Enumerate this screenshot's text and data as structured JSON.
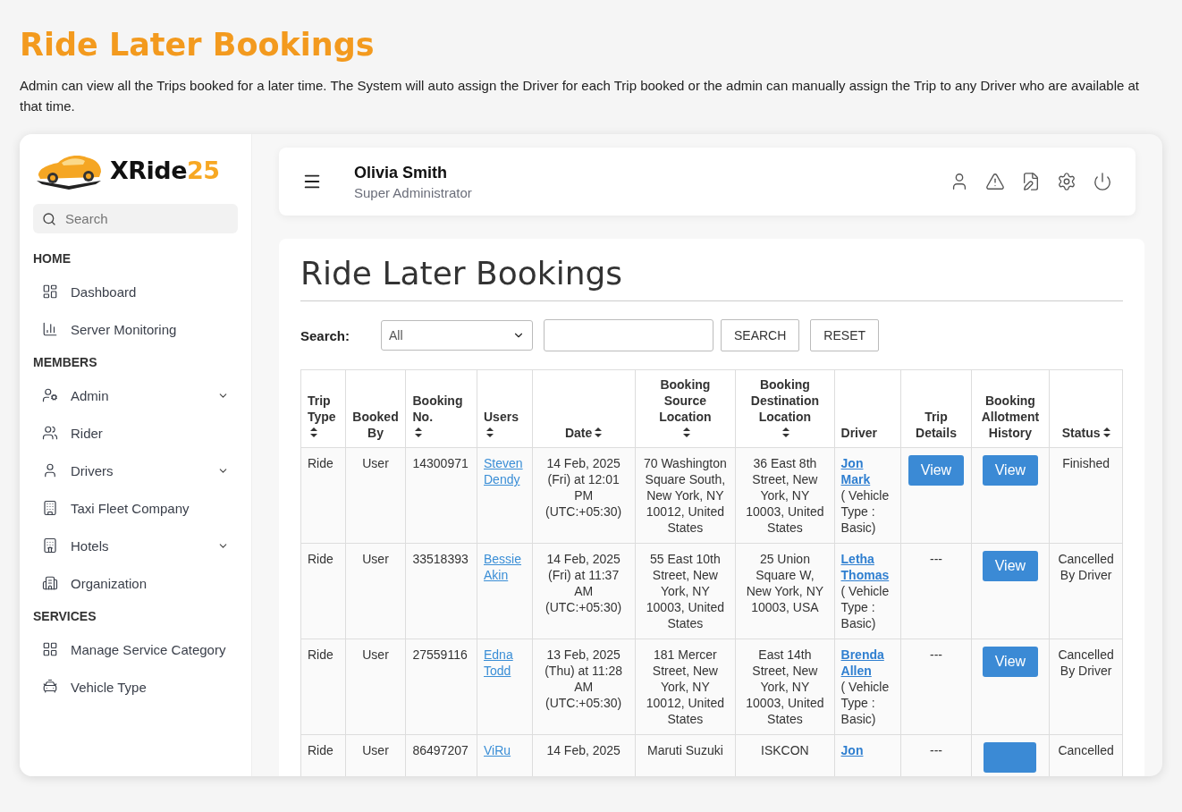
{
  "page": {
    "title": "Ride Later Bookings",
    "description": "Admin can view all the Trips booked for a later time. The System will auto assign the Driver for each Trip booked or the admin can manually assign the Trip to any Driver who are available at that time."
  },
  "sidebar": {
    "logo": {
      "text": "XRide",
      "accent": "25"
    },
    "search": {
      "placeholder": "Search"
    },
    "sections": [
      {
        "title": "HOME",
        "items": [
          {
            "label": "Dashboard",
            "expandable": false
          },
          {
            "label": "Server Monitoring",
            "expandable": false
          }
        ]
      },
      {
        "title": "MEMBERS",
        "items": [
          {
            "label": "Admin",
            "expandable": true
          },
          {
            "label": "Rider",
            "expandable": false
          },
          {
            "label": "Drivers",
            "expandable": true
          },
          {
            "label": "Taxi Fleet Company",
            "expandable": false
          },
          {
            "label": "Hotels",
            "expandable": true
          },
          {
            "label": "Organization",
            "expandable": false
          }
        ]
      },
      {
        "title": "SERVICES",
        "items": [
          {
            "label": "Manage Service Category",
            "expandable": false
          },
          {
            "label": "Vehicle Type",
            "expandable": false
          }
        ]
      }
    ]
  },
  "header": {
    "user_name": "Olivia Smith",
    "role": "Super Administrator"
  },
  "content": {
    "title": "Ride Later Bookings",
    "search": {
      "label": "Search:",
      "select_value": "All",
      "buttons": [
        "SEARCH",
        "RESET"
      ]
    },
    "table": {
      "columns": [
        {
          "label": "Trip Type",
          "sortable": true
        },
        {
          "label": "Booked By",
          "sortable": false
        },
        {
          "label": "Booking No.",
          "sortable": true
        },
        {
          "label": "Users",
          "sortable": true
        },
        {
          "label": "Date",
          "sortable": true
        },
        {
          "label": "Booking Source Location",
          "sortable": true
        },
        {
          "label": "Booking Destination Location",
          "sortable": true
        },
        {
          "label": "Driver",
          "sortable": false
        },
        {
          "label": "Trip Details",
          "sortable": false
        },
        {
          "label": "Booking Allotment History",
          "sortable": false
        },
        {
          "label": "Status",
          "sortable": true
        }
      ],
      "rows": [
        {
          "trip_type": "Ride",
          "booked_by": "User",
          "booking_no": "14300971",
          "user": "Steven Dendy",
          "date": "14 Feb, 2025 (Fri) at 12:01 PM (UTC:+05:30)",
          "source": "70 Washington Square South, New York, NY 10012, United States",
          "destination": "36 East 8th Street, New York, NY 10003, United States",
          "driver": "Jon Mark",
          "vehicle": "( Vehicle Type : Basic)",
          "trip_details": {
            "kind": "button",
            "text": "View"
          },
          "allotment": {
            "kind": "button",
            "text": "View"
          },
          "status": "Finished"
        },
        {
          "trip_type": "Ride",
          "booked_by": "User",
          "booking_no": "33518393",
          "user": "Bessie Akin",
          "date": "14 Feb, 2025 (Fri) at 11:37 AM (UTC:+05:30)",
          "source": "55 East 10th Street, New York, NY 10003, United States",
          "destination": "25 Union Square W, New York, NY 10003, USA",
          "driver": "Letha Thomas",
          "vehicle": "( Vehicle Type : Basic)",
          "trip_details": {
            "kind": "text",
            "text": "---"
          },
          "allotment": {
            "kind": "button",
            "text": "View"
          },
          "status": "Cancelled By Driver"
        },
        {
          "trip_type": "Ride",
          "booked_by": "User",
          "booking_no": "27559116",
          "user": "Edna Todd",
          "date": "13 Feb, 2025 (Thu) at 11:28 AM (UTC:+05:30)",
          "source": "181 Mercer Street, New York, NY 10012, United States",
          "destination": "East 14th Street, New York, NY 10003, United States",
          "driver": "Brenda Allen",
          "vehicle": "( Vehicle Type : Basic)",
          "trip_details": {
            "kind": "text",
            "text": "---"
          },
          "allotment": {
            "kind": "button",
            "text": "View"
          },
          "status": "Cancelled By Driver"
        },
        {
          "trip_type": "Ride",
          "booked_by": "User",
          "booking_no": "86497207",
          "user": "ViRu",
          "date": "14 Feb, 2025",
          "source": "Maruti Suzuki",
          "destination": "ISKCON",
          "driver": "Jon",
          "trip_details": {
            "kind": "text",
            "text": "---"
          },
          "allotment": {
            "kind": "button"
          },
          "status": "Cancelled"
        }
      ]
    }
  }
}
